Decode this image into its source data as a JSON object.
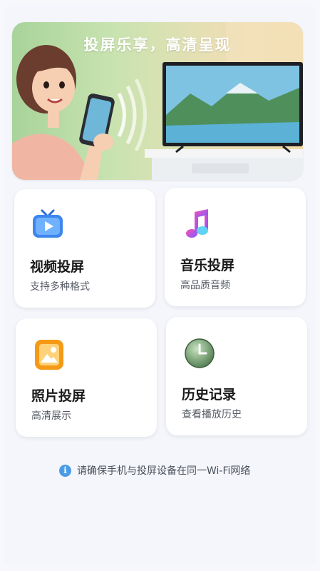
{
  "banner": {
    "title": "投屏乐享，高清呈现"
  },
  "cards": [
    {
      "title": "视频投屏",
      "subtitle": "支持多种格式",
      "icon": "tv-play-icon"
    },
    {
      "title": "音乐投屏",
      "subtitle": "高品质音频",
      "icon": "music-note-icon"
    },
    {
      "title": "照片投屏",
      "subtitle": "高清展示",
      "icon": "photo-icon"
    },
    {
      "title": "历史记录",
      "subtitle": "查看播放历史",
      "icon": "clock-icon"
    }
  ],
  "tip": {
    "icon": "info-icon",
    "symbol": "i",
    "text": "请确保手机与投屏设备在同一Wi-Fi网络"
  }
}
